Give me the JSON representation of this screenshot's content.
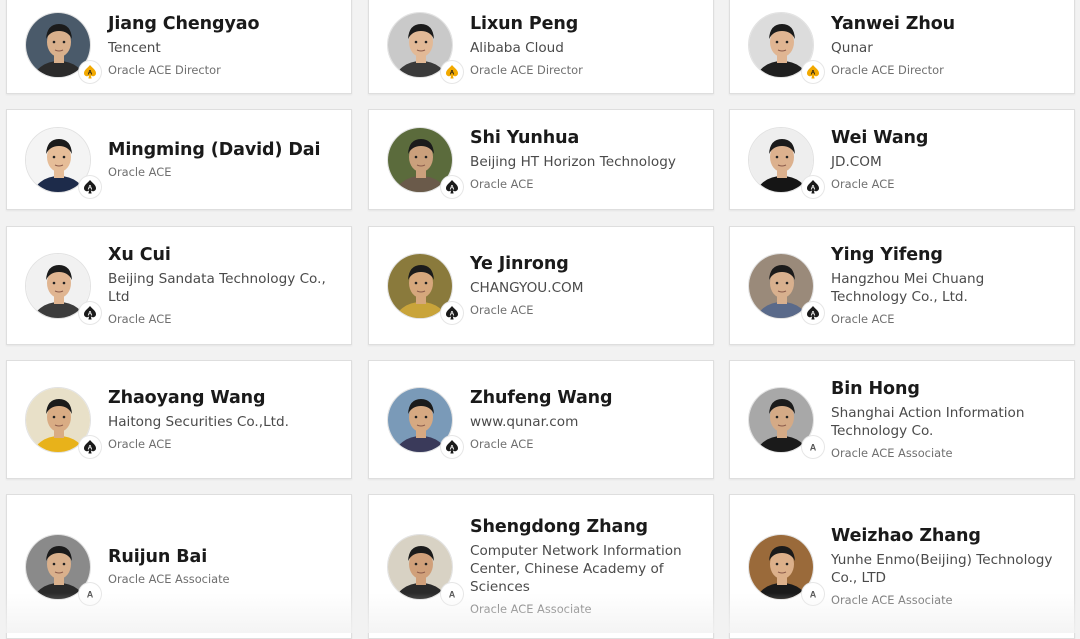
{
  "colors": {
    "director_badge": "#f2a900",
    "ace_badge": "#1a1a1a",
    "associate_badge": "#555555",
    "card_background": "#ffffff",
    "page_background": "#f2f2f2"
  },
  "members": [
    {
      "name": "Jiang Chengyao",
      "company": "Tencent",
      "level": "Oracle ACE Director",
      "badge": "director",
      "avatar_bg": "#4a5a6a",
      "skin": "#d9b08c",
      "shirt": "#2b2b2b"
    },
    {
      "name": "Lixun Peng",
      "company": "Alibaba Cloud",
      "level": "Oracle ACE Director",
      "badge": "director",
      "avatar_bg": "#c9c9c9",
      "skin": "#e2b996",
      "shirt": "#3a3a3a"
    },
    {
      "name": "Yanwei Zhou",
      "company": "Qunar",
      "level": "Oracle ACE Director",
      "badge": "director",
      "avatar_bg": "#dcdcdc",
      "skin": "#e0b592",
      "shirt": "#1f1f1f"
    },
    {
      "name": "Mingming (David) Dai",
      "company": "",
      "level": "Oracle ACE",
      "badge": "ace",
      "avatar_bg": "#f4f4f4",
      "skin": "#e6bd98",
      "shirt": "#1d2b4a"
    },
    {
      "name": "Shi Yunhua",
      "company": "Beijing HT Horizon Technology",
      "level": "Oracle ACE",
      "badge": "ace",
      "avatar_bg": "#5b6b3c",
      "skin": "#caa07c",
      "shirt": "#6a5a4a"
    },
    {
      "name": "Wei Wang",
      "company": "JD.COM",
      "level": "Oracle ACE",
      "badge": "ace",
      "avatar_bg": "#eeeeee",
      "skin": "#dcb18e",
      "shirt": "#151515"
    },
    {
      "name": "Xu Cui",
      "company": "Beijing Sandata Technology Co., Ltd",
      "level": "Oracle ACE",
      "badge": "ace",
      "avatar_bg": "#f1f1f1",
      "skin": "#e0b591",
      "shirt": "#3c3c3c"
    },
    {
      "name": "Ye Jinrong",
      "company": "CHANGYOU.COM",
      "level": "Oracle ACE",
      "badge": "ace",
      "avatar_bg": "#8a7a3c",
      "skin": "#d6a77c",
      "shirt": "#c9a43a"
    },
    {
      "name": "Ying Yifeng",
      "company": "Hangzhou Mei Chuang Technology Co., Ltd.",
      "level": "Oracle ACE",
      "badge": "ace",
      "avatar_bg": "#9a8a7a",
      "skin": "#d8b08e",
      "shirt": "#5a6a8a"
    },
    {
      "name": "Zhaoyang Wang",
      "company": "Haitong Securities Co.,Ltd.",
      "level": "Oracle ACE",
      "badge": "ace",
      "avatar_bg": "#e8e0c8",
      "skin": "#d9ac84",
      "shirt": "#e8b21a"
    },
    {
      "name": "Zhufeng Wang",
      "company": "www.qunar.com",
      "level": "Oracle ACE",
      "badge": "ace",
      "avatar_bg": "#7a9ab8",
      "skin": "#d6a982",
      "shirt": "#3a3a5a"
    },
    {
      "name": "Bin Hong",
      "company": "Shanghai Action Information Technology Co.",
      "level": "Oracle ACE Associate",
      "badge": "associate",
      "avatar_bg": "#a8a8a8",
      "skin": "#d4aa86",
      "shirt": "#1a1a1a"
    },
    {
      "name": "Ruijun Bai",
      "company": "",
      "level": "Oracle ACE Associate",
      "badge": "associate",
      "avatar_bg": "#8a8a8a",
      "skin": "#d9b08c",
      "shirt": "#2a2a2a"
    },
    {
      "name": "Shengdong Zhang",
      "company": "Computer Network Information Center, Chinese Academy of Sciences",
      "level": "Oracle ACE Associate",
      "badge": "associate",
      "avatar_bg": "#d8d2c4",
      "skin": "#d0a07a",
      "shirt": "#2a2a2a"
    },
    {
      "name": "Weizhao Zhang",
      "company": "Yunhe Enmo(Beijing) Technology Co., LTD",
      "level": "Oracle ACE Associate",
      "badge": "associate",
      "avatar_bg": "#9a6a3a",
      "skin": "#dcb08a",
      "shirt": "#1a1a1a"
    }
  ]
}
